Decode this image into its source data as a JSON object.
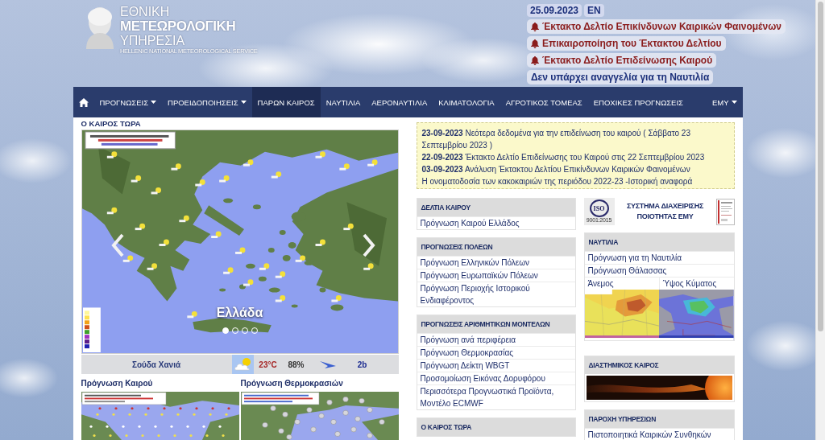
{
  "header": {
    "logo": {
      "line_1": "ΕΘΝΙΚΗ",
      "line_2": "ΜΕΤΕΩΡΟΛΟΓΙΚΗ",
      "line_3": "ΥΠΗΡΕΣΙΑ",
      "subtitle": "HELLENIC NATIONAL METEOROLOGICAL SERVICE"
    },
    "date": "25.09.2023",
    "language": "EN",
    "notices": [
      {
        "kind": "alert",
        "text": "Έκτακτο Δελτίο Επικίνδυνων Καιρικών Φαινομένων"
      },
      {
        "kind": "alert",
        "text": "Επικαιροποίηση του Έκτακτου Δελτίου"
      },
      {
        "kind": "alert",
        "text": "Έκτακτο Δελτίο Επιδείνωσης Καιρού"
      },
      {
        "kind": "info",
        "text": "Δεν υπάρχει αναγγελία για τη Ναυτιλία"
      }
    ]
  },
  "nav": {
    "items": [
      {
        "kind": "home",
        "selected": false
      },
      {
        "kind": "dropdown",
        "label": "ΠΡΟΓΝΩΣΕΙΣ",
        "selected": false
      },
      {
        "kind": "dropdown",
        "label": "ΠΡΟΕΙΔΟΠΟΙΗΣΕΙΣ",
        "selected": false
      },
      {
        "kind": "link",
        "label": "ΠΑΡΩΝ ΚΑΙΡΟΣ",
        "selected": true
      },
      {
        "kind": "link",
        "label": "ΝΑΥΤΙΛΙΑ",
        "selected": false
      },
      {
        "kind": "link",
        "label": "ΑΕΡΟΝΑΥΤΙΛΙΑ",
        "selected": false
      },
      {
        "kind": "link",
        "label": "ΚΛΙΜΑΤΟΛΟΓΙΑ",
        "selected": false
      },
      {
        "kind": "link",
        "label": "ΑΓΡΟΤΙΚΟΣ ΤΟΜΕΑΣ",
        "selected": false
      },
      {
        "kind": "link",
        "label": "ΕΠΟΧΙΚΕΣ ΠΡΟΓΝΩΣΕΙΣ",
        "selected": false
      }
    ],
    "right_menu": {
      "label": "ΕΜΥ"
    }
  },
  "current_weather": {
    "title": "Ο ΚΑΙΡΟΣ ΤΩΡΑ",
    "caption": "Ελλάδα",
    "slides": [
      {
        "selected": true
      },
      {
        "selected": false
      },
      {
        "selected": false
      },
      {
        "selected": false
      }
    ],
    "station": {
      "name": "Σούδα Χανιά",
      "temperature": "23°C",
      "humidity": "88%",
      "wind": "2b"
    }
  },
  "forecast_maps": [
    {
      "kind": "weather",
      "title": "Πρόγνωση Καιρού"
    },
    {
      "kind": "temperature",
      "title": "Πρόγνωση Θερμοκρασιών"
    }
  ],
  "news": [
    "**23-09-2023** Νεότερα δεδομένα για την επιδείνωση του καιρού ( Σάββατο 23 Σεπτεμβρίου 2023 )",
    "**22-09-2023** Έκτακτο Δελτίο Επιδείνωσης του Καιρού στις 22 Σεπτεμβρίου 2023",
    "**03-09-2023** Ανάλυση Έκτακτου Δελτίου Επικίνδυνων Καιρικών Φαινομένων",
    "Η ονοματοδοσία των κακοκαιριών της περιόδου 2022-23 -Ιστορική αναφορά"
  ],
  "link_panels": [
    {
      "title": "ΔΕΛΤΙΑ ΚΑΙΡΟΥ",
      "items": [
        "Πρόγνωση Καιρού Ελλάδος"
      ]
    },
    {
      "title": "ΠΡΟΓΝΩΣΕΙΣ ΠΟΛΕΩΝ",
      "items": [
        "Πρόγνωση Ελληνικών Πόλεων",
        "Πρόγνωση Ευρωπαϊκών Πόλεων",
        "Πρόγνωση Περιοχής Ιστορικού Ενδιαφέροντος"
      ]
    },
    {
      "title": "ΠΡΟΓΝΩΣΕΙΣ ΑΡΙΘΜΗΤΙΚΩΝ ΜΟΝΤΕΛΩΝ",
      "items": [
        "Πρόγνωση ανά περιφέρεια",
        "Πρόγνωση Θερμοκρασίας",
        "Πρόγνωση Δείκτη WBGT",
        "Προσομοίωση Εικόνας Δορυφόρου",
        "Περισσότερα Προγνωστικά Προϊόντα, Μοντέλο ECMWF"
      ]
    },
    {
      "title": "Ο ΚΑΙΡΟΣ ΤΩΡΑ"
    }
  ],
  "quality_badge": {
    "logo_text": "ISO",
    "logo_caption": "9001:2015",
    "text": "ΣΥΣΤΗΜΑ ΔΙΑΧΕΙΡΙΣΗΣ ΠΟΙΟΤΗΤΑΣ ΕΜΥ"
  },
  "side_panels": [
    {
      "kind": "links",
      "title": "ΝΑΥΤΙΛΙΑ",
      "items": [
        "Πρόγνωση για τη Ναυτιλία",
        "Πρόγνωση Θάλασσας"
      ],
      "maps": [
        {
          "kind": "wind",
          "label": "Άνεμος"
        },
        {
          "kind": "waves",
          "label": "Ύψος Κύματος"
        }
      ]
    },
    {
      "kind": "image",
      "title": "ΔΙΑΣΤΗΜΙΚΟΣ ΚΑΙΡΟΣ"
    },
    {
      "kind": "links",
      "title": "ΠΑΡΟΧΗ ΥΠΗΡΕΣΙΩΝ",
      "items": [
        "Πιστοποιητικά Καιρικών Συνθηκών"
      ]
    }
  ]
}
